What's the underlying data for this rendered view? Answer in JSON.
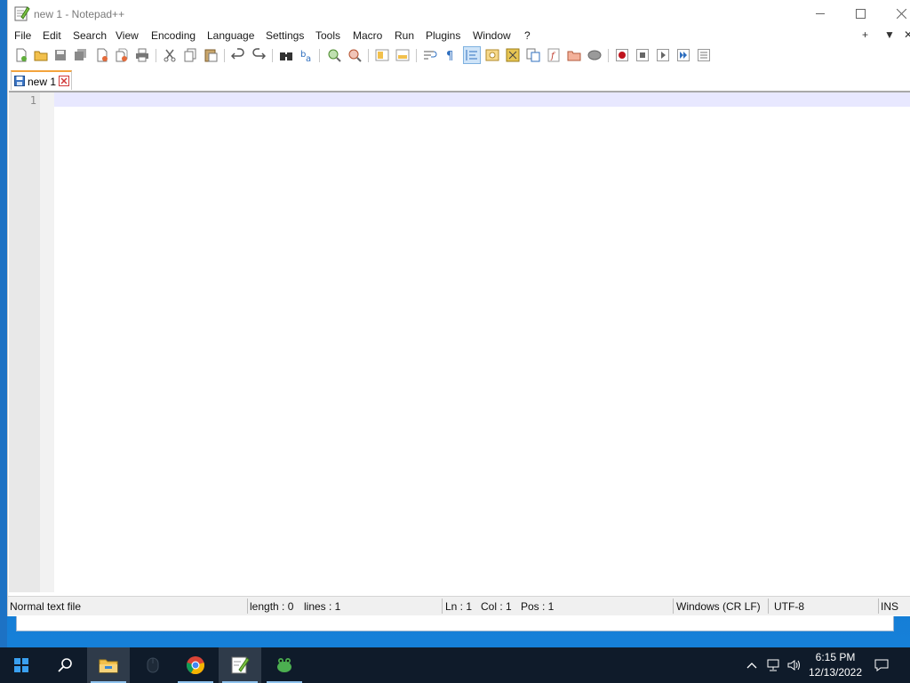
{
  "window": {
    "title": "new 1 - Notepad++",
    "app_icon": "notepadpp-icon"
  },
  "menu": {
    "items": [
      "File",
      "Edit",
      "Search",
      "View",
      "Encoding",
      "Language",
      "Settings",
      "Tools",
      "Macro",
      "Run",
      "Plugins",
      "Window",
      "?"
    ],
    "extras": [
      "+",
      "▼",
      "✕"
    ]
  },
  "toolbar": {
    "buttons": [
      "new",
      "open",
      "save",
      "save-all",
      "close",
      "close-all",
      "print",
      "cut",
      "copy",
      "paste",
      "undo",
      "redo",
      "find",
      "replace",
      "zoom-in",
      "zoom-out",
      "sync-vertical",
      "sync-horizontal",
      "word-wrap",
      "show-all-characters",
      "indent-guide",
      "udl",
      "doc-map",
      "doc-list",
      "function-list",
      "folder-as-workspace",
      "monitoring",
      "record-macro",
      "stop-record",
      "playback",
      "run-macro-multiple",
      "save-macro"
    ],
    "active": "indent-guide"
  },
  "tabs": [
    {
      "label": "new 1",
      "icon": "save-icon",
      "active": true
    }
  ],
  "editor": {
    "line_numbers": [
      "1"
    ],
    "content": "",
    "current_line_color": "#e8e8ff"
  },
  "statusbar": {
    "file_type": "Normal text file",
    "length": "length : 0",
    "lines": "lines : 1",
    "ln": "Ln : 1",
    "col": "Col : 1",
    "pos": "Pos : 1",
    "eol": "Windows (CR LF)",
    "encoding": "UTF-8",
    "mode": "INS"
  },
  "taskbar": {
    "items": [
      "start",
      "search",
      "file-explorer",
      "mouse-app",
      "chrome",
      "notepadpp",
      "frog-app"
    ],
    "clock_time": "6:15 PM",
    "clock_date": "12/13/2022"
  },
  "colors": {
    "accent_tab": "#f3a33c",
    "taskbar": "#0f1b2a",
    "desktop": "#0f73cc"
  }
}
